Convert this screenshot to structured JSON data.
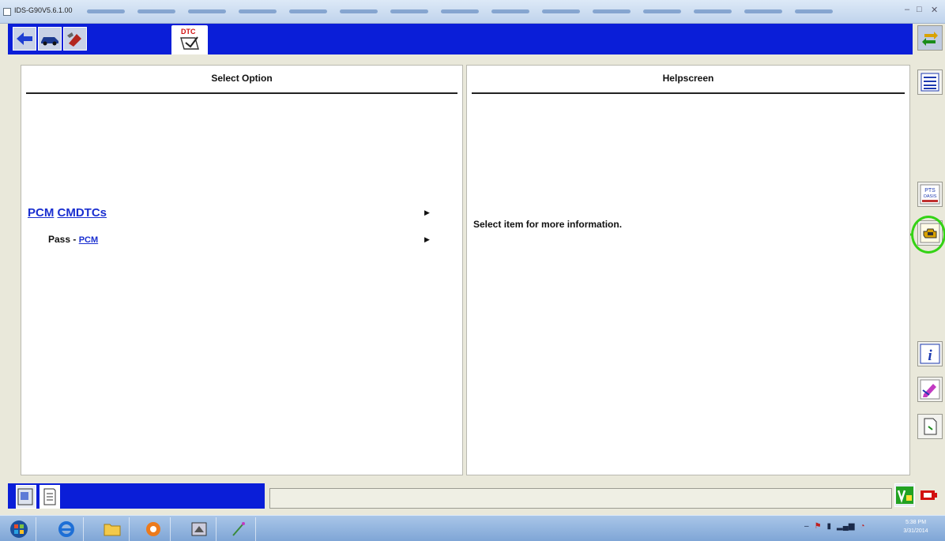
{
  "window": {
    "title": "IDS-G90V5.6.1.00",
    "min_glyph": "–",
    "max_glyph": "□",
    "close_glyph": "✕"
  },
  "toolbar": {
    "dtc_tab_label": "DTC"
  },
  "select_option": {
    "header": "Select Option",
    "items": [
      {
        "words": [
          "PCM",
          "CMDTCs"
        ],
        "arrow": "▶"
      },
      {
        "prefix": "Pass - ",
        "link": "PCM",
        "arrow": "▶"
      }
    ]
  },
  "helpscreen": {
    "header": "Helpscreen",
    "message": "Select item for more information."
  },
  "sidebar": {
    "pts_label_1": "PTS",
    "pts_label_2": "OASIS",
    "info_glyph": "i"
  },
  "colors": {
    "toolbar_blue": "#0a1ed8",
    "link_blue": "#1a2fd0",
    "highlight_green": "#34d315",
    "panel_bg": "#ffffff",
    "chrome_bg": "#e9e8da"
  },
  "taskbar": {
    "clock_time": "5:38 PM",
    "clock_date": "3/31/2014"
  }
}
